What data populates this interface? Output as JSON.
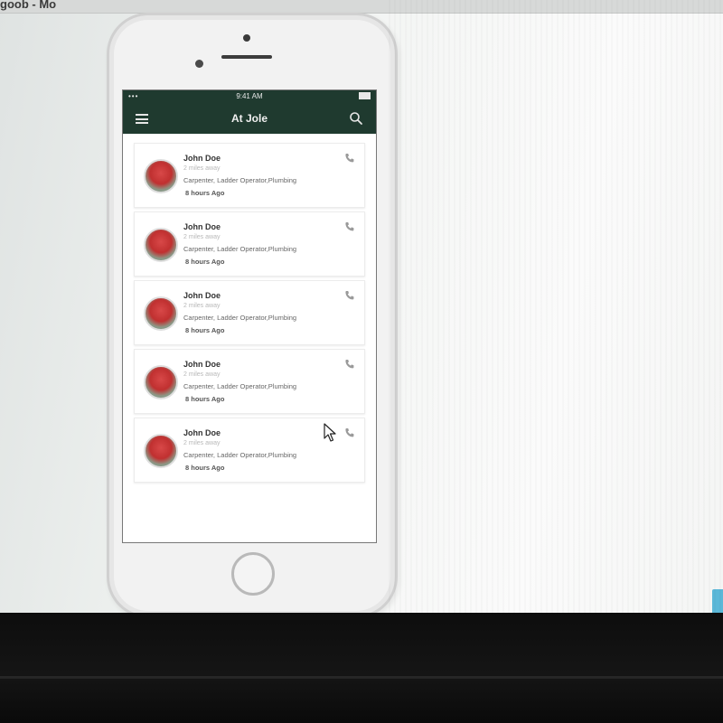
{
  "browser": {
    "tab_title": "goob - Mo"
  },
  "phone": {
    "status_bar": {
      "left": "•••",
      "time": "9:41 AM"
    },
    "app": {
      "title": "At Jole",
      "menu_icon": "hamburger-menu-icon",
      "search_icon": "search-icon"
    },
    "workers": [
      {
        "name": "John Doe",
        "distance": "2 miles away",
        "skills": "Carpenter, Ladder Operator,Plumbing",
        "time": "8 hours Ago"
      },
      {
        "name": "John Doe",
        "distance": "2 miles away",
        "skills": "Carpenter, Ladder Operator,Plumbing",
        "time": "8 hours Ago"
      },
      {
        "name": "John Doe",
        "distance": "2 miles away",
        "skills": "Carpenter, Ladder Operator,Plumbing",
        "time": "8 hours Ago"
      },
      {
        "name": "John Doe",
        "distance": "2 miles away",
        "skills": "Carpenter, Ladder Operator,Plumbing",
        "time": "8 hours Ago"
      },
      {
        "name": "John Doe",
        "distance": "2 miles away",
        "skills": "Carpenter, Ladder Operator,Plumbing",
        "time": "8 hours Ago"
      }
    ]
  },
  "colors": {
    "nav_bar": "#1f3a2f",
    "avatar_accent": "#c03030",
    "corner_button": "#5bb8d8"
  }
}
